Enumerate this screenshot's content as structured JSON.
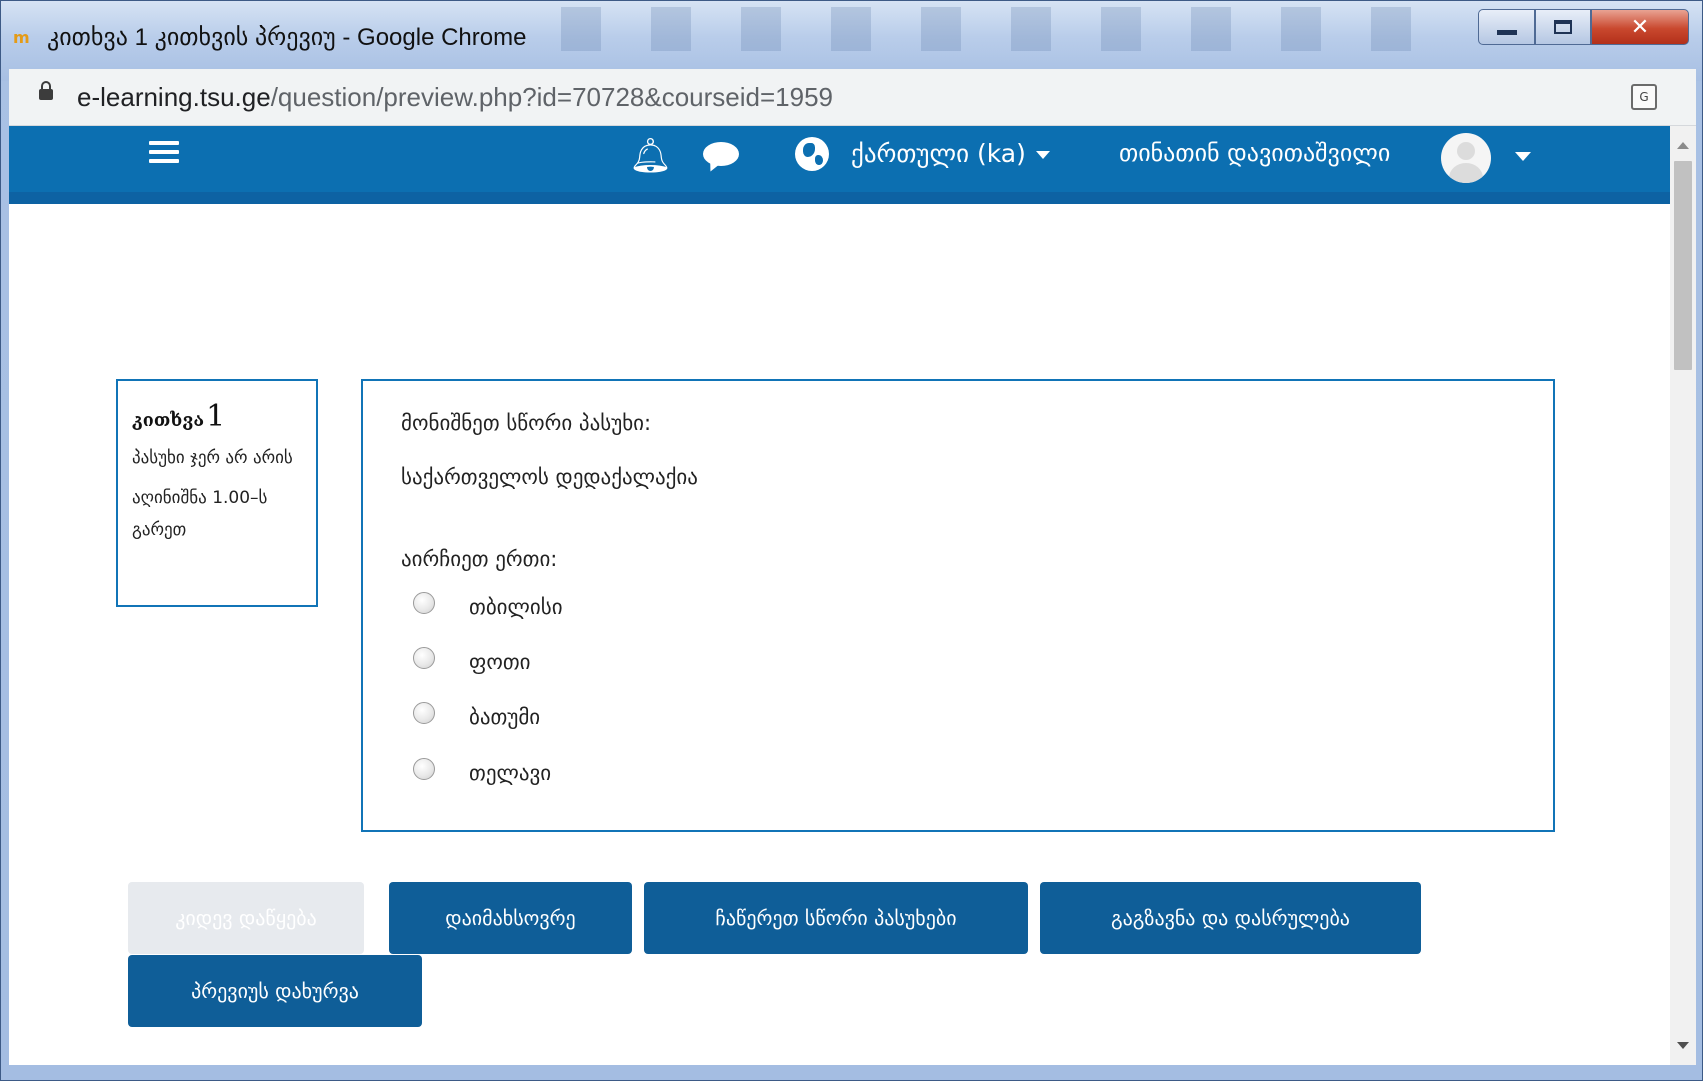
{
  "window": {
    "title": "კითხვა 1 კითხვის პრევიუ - Google Chrome",
    "app_icon_text": "m"
  },
  "addressbar": {
    "url_host": "e-learning.tsu.ge",
    "url_path": "/question/preview.php?id=70728&courseid=1959"
  },
  "navbar": {
    "language_label": "ქართული (ka)",
    "user_name": "თინათინ დავითაშვილი",
    "color": "#0c6fb1"
  },
  "info": {
    "question_word": "კითხვა",
    "question_number": "1",
    "status": "პასუხი ჯერ არ არის",
    "mark": "აღინიშნა 1.00–ს გარეთ"
  },
  "question": {
    "prompt": "მონიშნეთ სწორი პასუხი:",
    "stem": "საქართველოს დედაქალაქია",
    "select_label": "აირჩიეთ ერთი:",
    "options": [
      "თბილისი",
      "ფოთი",
      "ბათუმი",
      "თელავი"
    ]
  },
  "buttons": {
    "restart": "კიდევ დაწყება",
    "save": "დაიმახსოვრე",
    "fill_correct": "ჩაწერეთ სწორი პასუხები",
    "submit_finish": "გაგზავნა და დასრულება",
    "close_preview": "პრევიუს დახურვა"
  },
  "icons": {
    "menu": "hamburger-icon",
    "notifications": "bell-icon",
    "messages": "chat-icon",
    "language": "globe-icon",
    "lock": "lock-icon",
    "translate": "translate-icon"
  }
}
